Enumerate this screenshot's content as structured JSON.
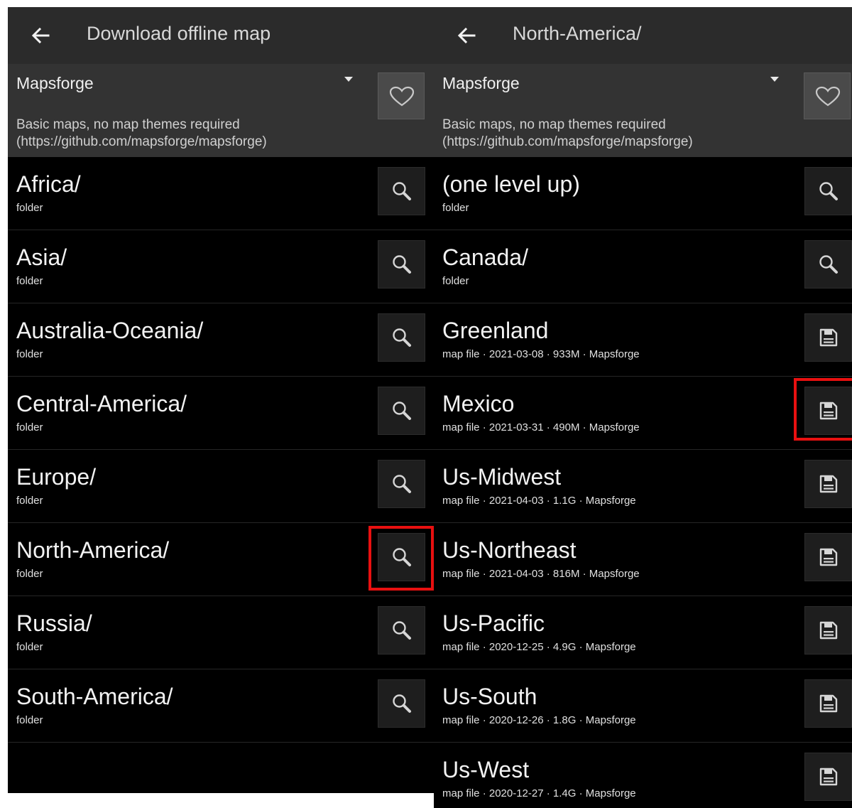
{
  "left_panel": {
    "title": "Download offline map",
    "source_name": "Mapsforge",
    "description_line1": "Basic maps, no map themes required",
    "description_line2": "(https://github.com/mapsforge/mapsforge)",
    "items": [
      {
        "name": "Africa/",
        "sub": "folder",
        "icon": "search-icon"
      },
      {
        "name": "Asia/",
        "sub": "folder",
        "icon": "search-icon"
      },
      {
        "name": "Australia-Oceania/",
        "sub": "folder",
        "icon": "search-icon"
      },
      {
        "name": "Central-America/",
        "sub": "folder",
        "icon": "search-icon"
      },
      {
        "name": "Europe/",
        "sub": "folder",
        "icon": "search-icon"
      },
      {
        "name": "North-America/",
        "sub": "folder",
        "icon": "search-icon",
        "highlighted": true
      },
      {
        "name": "Russia/",
        "sub": "folder",
        "icon": "search-icon"
      },
      {
        "name": "South-America/",
        "sub": "folder",
        "icon": "search-icon"
      }
    ]
  },
  "right_panel": {
    "title": "North-America/",
    "source_name": "Mapsforge",
    "description_line1": "Basic maps, no map themes required",
    "description_line2": "(https://github.com/mapsforge/mapsforge)",
    "items": [
      {
        "name": "(one level up)",
        "sub": "folder",
        "icon": "search-icon"
      },
      {
        "name": "Canada/",
        "sub": "folder",
        "icon": "search-icon"
      },
      {
        "name": "Greenland",
        "sub": "map file · 2021-03-08 · 933M · Mapsforge",
        "icon": "save-icon"
      },
      {
        "name": "Mexico",
        "sub": "map file · 2021-03-31 · 490M · Mapsforge",
        "icon": "save-icon",
        "highlighted": true
      },
      {
        "name": "Us-Midwest",
        "sub": "map file · 2021-04-03 · 1.1G · Mapsforge",
        "icon": "save-icon"
      },
      {
        "name": "Us-Northeast",
        "sub": "map file · 2021-04-03 · 816M · Mapsforge",
        "icon": "save-icon"
      },
      {
        "name": "Us-Pacific",
        "sub": "map file · 2020-12-25 · 4.9G · Mapsforge",
        "icon": "save-icon"
      },
      {
        "name": "Us-South",
        "sub": "map file · 2020-12-26 · 1.8G · Mapsforge",
        "icon": "save-icon"
      },
      {
        "name": "Us-West",
        "sub": "map file · 2020-12-27 · 1.4G · Mapsforge",
        "icon": "save-icon"
      }
    ]
  },
  "colors": {
    "highlight": "#e81010",
    "appbar": "#2b2b2b",
    "sourcebar": "#333333",
    "list_background": "#000000"
  }
}
